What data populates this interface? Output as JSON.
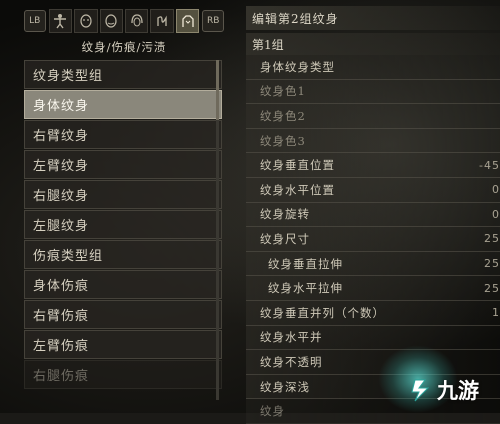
{
  "tabs": {
    "lb_label": "LB",
    "rb_label": "RB",
    "icons": [
      "body-icon",
      "face-icon",
      "face-paint-icon",
      "hair-icon",
      "tattoo-icon",
      "tattoo-active-icon"
    ]
  },
  "left": {
    "title": "纹身/伤痕/污渍",
    "items": [
      "纹身类型组",
      "身体纹身",
      "右臂纹身",
      "左臂纹身",
      "右腿纹身",
      "左腿纹身",
      "伤痕类型组",
      "身体伤痕",
      "右臂伤痕",
      "左臂伤痕",
      "右腿伤痕"
    ],
    "selected_index": 1
  },
  "right": {
    "header": "编辑第2组纹身",
    "group": "第1组",
    "params": [
      {
        "label": "身体纹身类型",
        "value": ""
      },
      {
        "label": "纹身色1",
        "value": ""
      },
      {
        "label": "纹身色2",
        "value": ""
      },
      {
        "label": "纹身色3",
        "value": ""
      },
      {
        "label": "纹身垂直位置",
        "value": "-45"
      },
      {
        "label": "纹身水平位置",
        "value": "0"
      },
      {
        "label": "纹身旋转",
        "value": "0"
      },
      {
        "label": "纹身尺寸",
        "value": "25"
      },
      {
        "label": "纹身垂直拉伸",
        "value": "25"
      },
      {
        "label": "纹身水平拉伸",
        "value": "25"
      },
      {
        "label": "纹身垂直并列（个数）",
        "value": "1"
      },
      {
        "label": "纹身水平并",
        "value": ""
      },
      {
        "label": "纹身不透明",
        "value": ""
      },
      {
        "label": "纹身深浅",
        "value": ""
      },
      {
        "label": "纹身",
        "value": ""
      }
    ]
  },
  "watermark": {
    "text": "九游"
  }
}
